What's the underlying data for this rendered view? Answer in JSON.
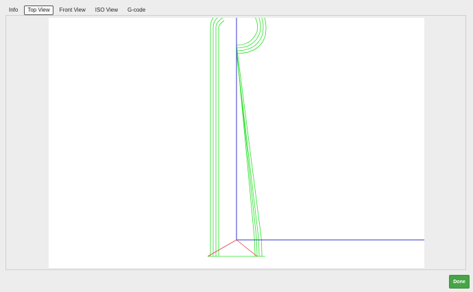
{
  "tabs": [
    {
      "label": "Info",
      "active": false
    },
    {
      "label": "Top View",
      "active": true
    },
    {
      "label": "Front View",
      "active": false
    },
    {
      "label": "ISO View",
      "active": false
    },
    {
      "label": "G-code",
      "active": false
    }
  ],
  "footer": {
    "done_label": "Done"
  },
  "colors": {
    "toolpath": "#22e022",
    "axis_x": "#3333cc",
    "axis_y": "#3333cc",
    "tool_cone": "#e03333",
    "done_button": "#47a447"
  }
}
